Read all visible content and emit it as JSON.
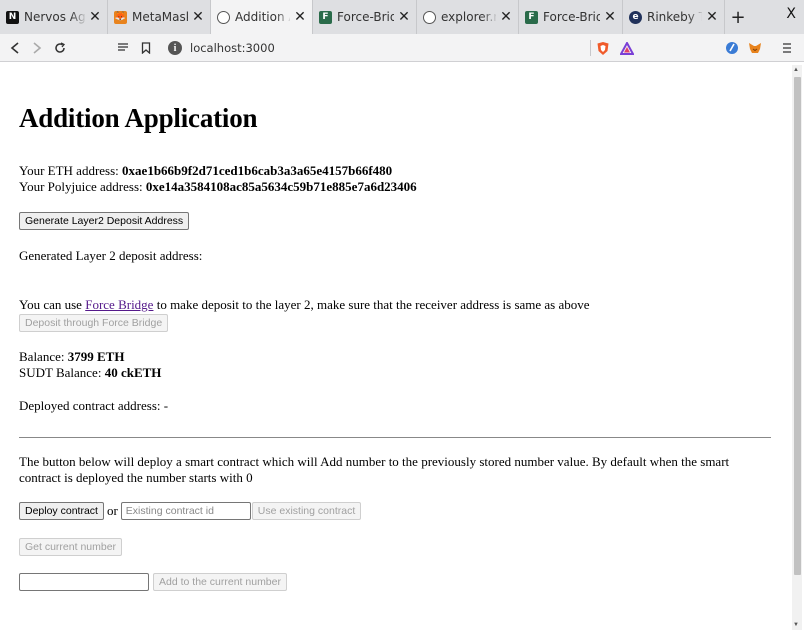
{
  "browser": {
    "tabs": [
      {
        "title": "Nervos Aggregator",
        "favicon": "nervos-favicon",
        "active": false
      },
      {
        "title": "MetaMask",
        "favicon": "metamask-fox-favicon",
        "active": false
      },
      {
        "title": "Addition Application",
        "favicon": "globe-favicon",
        "active": true
      },
      {
        "title": "Force-Bridge",
        "favicon": "force-bridge-favicon",
        "active": false
      },
      {
        "title": "explorer.nervos.org",
        "favicon": "globe-favicon",
        "active": false
      },
      {
        "title": "Force-Bridge",
        "favicon": "force-bridge-favicon",
        "active": false
      },
      {
        "title": "Rinkeby Transaction",
        "favicon": "etherscan-favicon",
        "active": false
      }
    ],
    "new_tab": "+",
    "window_close": "X",
    "url": "localhost:3000"
  },
  "page": {
    "title": "Addition Application",
    "eth_address_label": "Your ETH address: ",
    "eth_address": "0xae1b66b9f2d71ced1b6cab3a3a65e4157b66f480",
    "polyjuice_address_label": "Your Polyjuice address: ",
    "polyjuice_address": "0xe14a3584108ac85a5634c59b71e885e7a6d23406",
    "generate_button": "Generate Layer2 Deposit Address",
    "deposit_address_label": "Generated Layer 2 deposit address:",
    "deposit_note_prefix": "You can use ",
    "deposit_note_link": "Force Bridge",
    "deposit_note_suffix": " to make deposit to the layer 2, make sure that the receiver address is same as above",
    "deposit_button": "Deposit through Force Bridge",
    "balance_label": "Balance: ",
    "balance_value": "3799 ETH",
    "sudt_label": "SUDT Balance: ",
    "sudt_value": "40 ckETH",
    "deployed_label": "Deployed contract address: -",
    "description": "The button below will deploy a smart contract which will Add number to the previously stored number value. By default when the smart contract is deployed the number starts with 0",
    "deploy_button": "Deploy contract",
    "or_text": "or",
    "contract_id_placeholder": "Existing contract id",
    "use_existing_button": "Use existing contract",
    "get_number_button": "Get current number",
    "add_number_value": "",
    "add_number_button": "Add to the current number"
  }
}
